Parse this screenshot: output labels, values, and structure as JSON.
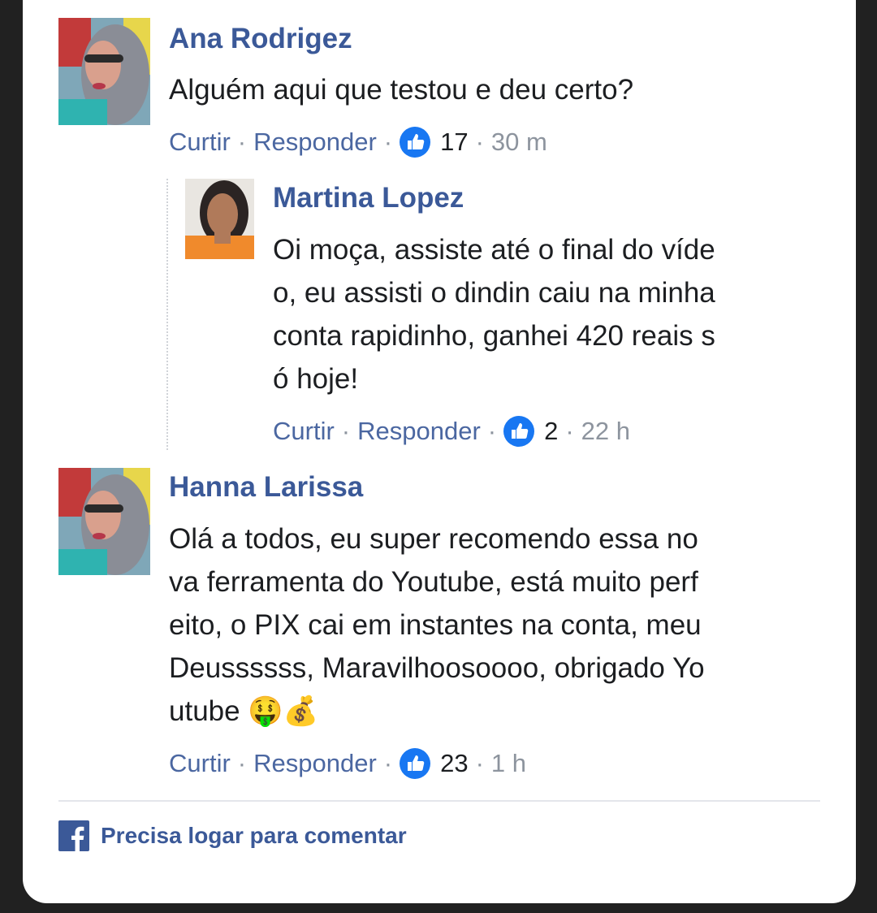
{
  "comments": [
    {
      "author": "Ana Rodrigez",
      "text": "Alguém aqui que testou e deu certo?",
      "like_label": "Curtir",
      "reply_label": "Responder",
      "separator": "·",
      "likes": "17",
      "time": "30 m"
    },
    {
      "author": "Martina Lopez",
      "text": "Oi moça, assiste até o final do víde\no, eu assisti o dindin caiu na minha\nconta rapidinho, ganhei 420 reais s\nó hoje!",
      "like_label": "Curtir",
      "reply_label": "Responder",
      "separator": "·",
      "likes": "2",
      "time": "22 h"
    },
    {
      "author": "Hanna Larissa",
      "text": "Olá a todos, eu super recomendo essa no\nva ferramenta do Youtube, está muito perf\neito, o PIX cai em instantes na conta, meu\nDeussssss, Maravilhoosoooo, obrigado Yo\nutube 🤑💰",
      "like_label": "Curtir",
      "reply_label": "Responder",
      "separator": "·",
      "likes": "23",
      "time": "1 h"
    }
  ],
  "footer": {
    "icon": "facebook-icon",
    "text": "Precisa logar para comentar"
  },
  "colors": {
    "author": "#3b5998",
    "link": "#4b67a1",
    "meta": "#8d949e",
    "like_blue": "#1877f2",
    "background": "#212121"
  }
}
